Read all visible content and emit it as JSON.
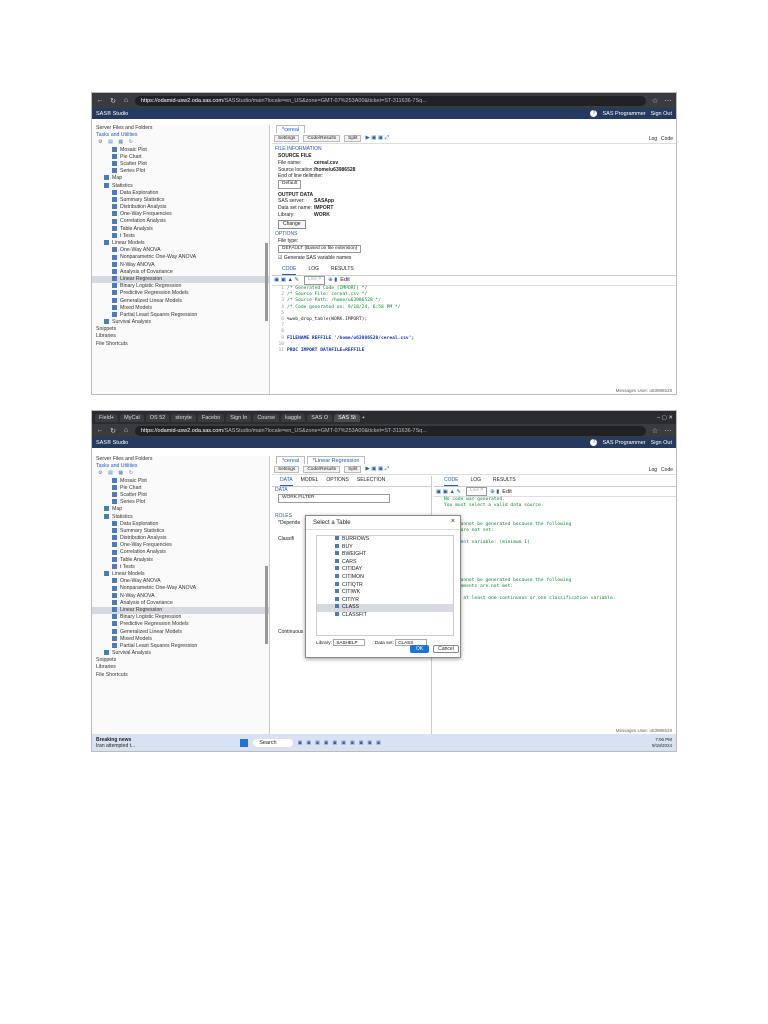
{
  "shot1": {
    "browser": {
      "url_host": "https://odamid-usw2.oda.sas.com",
      "url_path": "/SASStudio/main?locale=en_US&zone=GMT-07%253A00&ticket=ST-311636-7Sq..."
    },
    "app": {
      "title": "SAS® Studio",
      "role": "SAS Programmer",
      "signout": "Sign Out"
    },
    "sidebar": {
      "top": [
        "Server Files and Folders",
        "Tasks and Utilities"
      ],
      "items": [
        "Mosaic Plot",
        "Pie Chart",
        "Scatter Plot",
        "Series Plot",
        "Map",
        "Statistics",
        "Data Exploration",
        "Summary Statistics",
        "Distribution Analysis",
        "One-Way Frequencies",
        "Correlation Analysis",
        "Table Analysis",
        "t Tests",
        "Linear Models",
        "One-Way ANOVA",
        "Nonparametric One-Way ANOVA",
        "N-Way ANOVA",
        "Analysis of Covariance",
        "Linear Regression",
        "Binary Logistic Regression",
        "Predictive Regression Models",
        "Generalized Linear Models",
        "Mixed Models",
        "Partial Least Squares Regression",
        "Survival Analysis"
      ],
      "bottom": [
        "Snippets",
        "Libraries",
        "File Shortcuts"
      ]
    },
    "main": {
      "file_tab": "*cereal",
      "subtabs": [
        "Settings",
        "Code/Results",
        "Split"
      ],
      "right_tools": [
        "Log",
        "Code"
      ],
      "file_info_header": "FILE INFORMATION",
      "source_file": "SOURCE FILE",
      "file_name_label": "File name:",
      "file_name": "cereal.csv",
      "source_location_label": "Source location:",
      "source_location": "/home/u63986528",
      "eol_label": "End of line delimiter:",
      "eol_value": "Default",
      "output_data": "OUTPUT DATA",
      "sas_server_label": "SAS server:",
      "sas_server": "SASApp",
      "dataset_label": "Data set name:",
      "dataset": "IMPORT",
      "library_label": "Library:",
      "library": "WORK",
      "change_btn": "Change",
      "options_header": "OPTIONS",
      "filetype_label": "File type:",
      "filetype_value": "DEFAULT (Based on file extension)",
      "gen_names": "Generate SAS variable names",
      "code_tabs": [
        "CODE",
        "LOG",
        "RESULTS"
      ],
      "line_label": "Line #",
      "edit_label": "Edit",
      "code_lines": [
        {
          "n": "1",
          "t": "/* Generated Code (IMPORT) */",
          "c": "green"
        },
        {
          "n": "2",
          "t": "/* Source File: cereal.csv */",
          "c": "green"
        },
        {
          "n": "3",
          "t": "/* Source Path: /home/u63986528 */",
          "c": "green"
        },
        {
          "n": "4",
          "t": "/* Code generated on: 9/18/24, 6:58 PM */",
          "c": "green"
        },
        {
          "n": "5",
          "t": "",
          "c": ""
        },
        {
          "n": "6",
          "t": "%web_drop_table(WORK.IMPORT);",
          "c": ""
        },
        {
          "n": "7",
          "t": "",
          "c": ""
        },
        {
          "n": "8",
          "t": "",
          "c": ""
        },
        {
          "n": "9",
          "t": "FILENAME REFFILE '/home/u63986528/cereal.csv';",
          "c": "blue"
        },
        {
          "n": "10",
          "t": "",
          "c": ""
        },
        {
          "n": "11",
          "t": "PROC IMPORT DATAFILE=REFFILE",
          "c": "blue"
        }
      ],
      "status": "Messages   User: u63986528"
    }
  },
  "shot2": {
    "tabs": [
      "Field+",
      "MyCal",
      "OS 52",
      "storyte",
      "Facebo",
      "Sign In",
      "Course",
      "kaggle",
      "SAS O",
      "SAS St"
    ],
    "browser": {
      "url_host": "https://odamid-usw2.oda.sas.com",
      "url_path": "/SASStudio/main?locale=en_US&zone=GMT-07%253A00&ticket=ST-311636-7Sq..."
    },
    "app": {
      "title": "SAS® Studio",
      "role": "SAS Programmer",
      "signout": "Sign Out"
    },
    "main": {
      "file_tabs": [
        "*cereal",
        "*Linear Regression"
      ],
      "subtabs": [
        "Settings",
        "Code/Results",
        "Split"
      ],
      "task_tabs": [
        "DATA",
        "MODEL",
        "OPTIONS",
        "SELECTION"
      ],
      "data_label": "DATA",
      "data_value": "WORK.FILTER",
      "roles_label": "ROLES",
      "dependent_label": "*Depende",
      "classif_label": "Classifi",
      "continuous_label": "Continuous",
      "code_tabs": [
        "CODE",
        "LOG",
        "RESULTS"
      ],
      "edit_label": "Edit",
      "line_label": "Line #",
      "messages": [
        "No code was generated.",
        "You must select a valid data source.",
        "",
        "",
        "Code cannot be generated because the following",
        "roles are not set:",
        "",
        "  Dependent variable: (minimum 1)",
        "",
        "",
        "",
        "",
        "",
        "Code cannot be generated because the following",
        "requirements are not met:",
        "",
        "Select at least one continuous or one classification variable."
      ],
      "status": "Messages   User: u63986528"
    },
    "dialog": {
      "title": "Select a Table",
      "tables": [
        "BURROWS",
        "BUY",
        "BWEIGHT",
        "CARS",
        "CITIDAY",
        "CITIMON",
        "CITIQTR",
        "CITIWK",
        "CITIYR",
        "CLASS",
        "CLASSFIT"
      ],
      "selected": "CLASS",
      "library_label": "Library:",
      "library_value": "SASHELP",
      "dataset_label": "Data set:",
      "dataset_value": "CLASS",
      "ok": "OK",
      "cancel": "Cancel"
    },
    "taskbar": {
      "news_title": "Breaking news",
      "news_sub": "Iran attempted t...",
      "search": "Search",
      "time": "7:06 PM",
      "date": "9/18/2024"
    }
  }
}
